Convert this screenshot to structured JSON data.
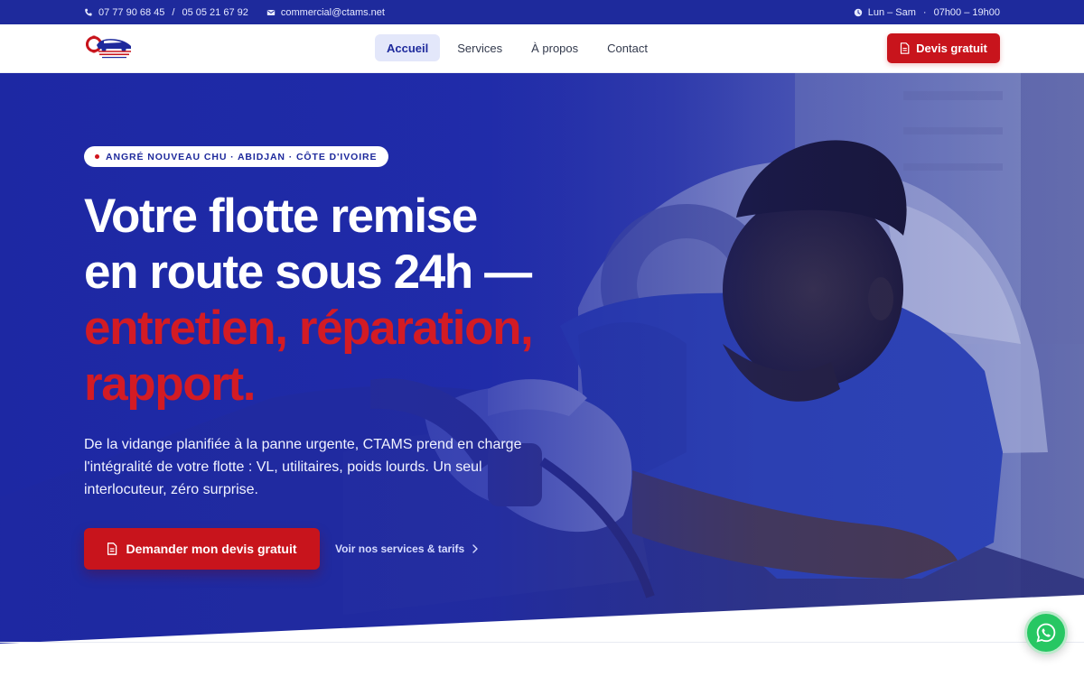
{
  "topbar": {
    "phone1": "07 77 90 68 45",
    "separator": "/",
    "phone2": "05 05 21 67 92",
    "email": "commercial@ctams.net",
    "hours_days": "Lun – Sam",
    "hours_dot": "·",
    "hours_time": "07h00 – 19h00",
    "icons": [
      "phone-icon",
      "mail-icon",
      "clock-icon"
    ]
  },
  "navbar": {
    "logo_alt": "CTAMS logo",
    "items": [
      {
        "label": "Accueil",
        "active": true
      },
      {
        "label": "Services",
        "active": false
      },
      {
        "label": "À propos",
        "active": false
      },
      {
        "label": "Contact",
        "active": false
      }
    ],
    "cta_label": "Devis gratuit",
    "cta_icon": "document-icon"
  },
  "hero": {
    "badge": "ANGRÉ NOUVEAU CHU · ABIDJAN · CÔTE D'IVOIRE",
    "title_line1": "Votre flotte remise",
    "title_line2": "en route sous 24h —",
    "title_line3": "entretien, réparation,",
    "title_line4": "rapport.",
    "lead": "De la vidange planifiée à la panne urgente, CTAMS prend en charge l'intégralité de votre flotte : VL, utilitaires, poids lourds. Un seul interlocuteur, zéro surprise.",
    "cta_primary": "Demander mon devis gratuit",
    "cta_secondary": "Voir nos services & tarifs",
    "cta_secondary_icon": "chevron-right-icon"
  },
  "floating": {
    "whatsapp_icon": "whatsapp-icon"
  },
  "colors": {
    "brand_blue": "#1e2a9c",
    "brand_red": "#c8141c",
    "whatsapp_green": "#27c763"
  }
}
